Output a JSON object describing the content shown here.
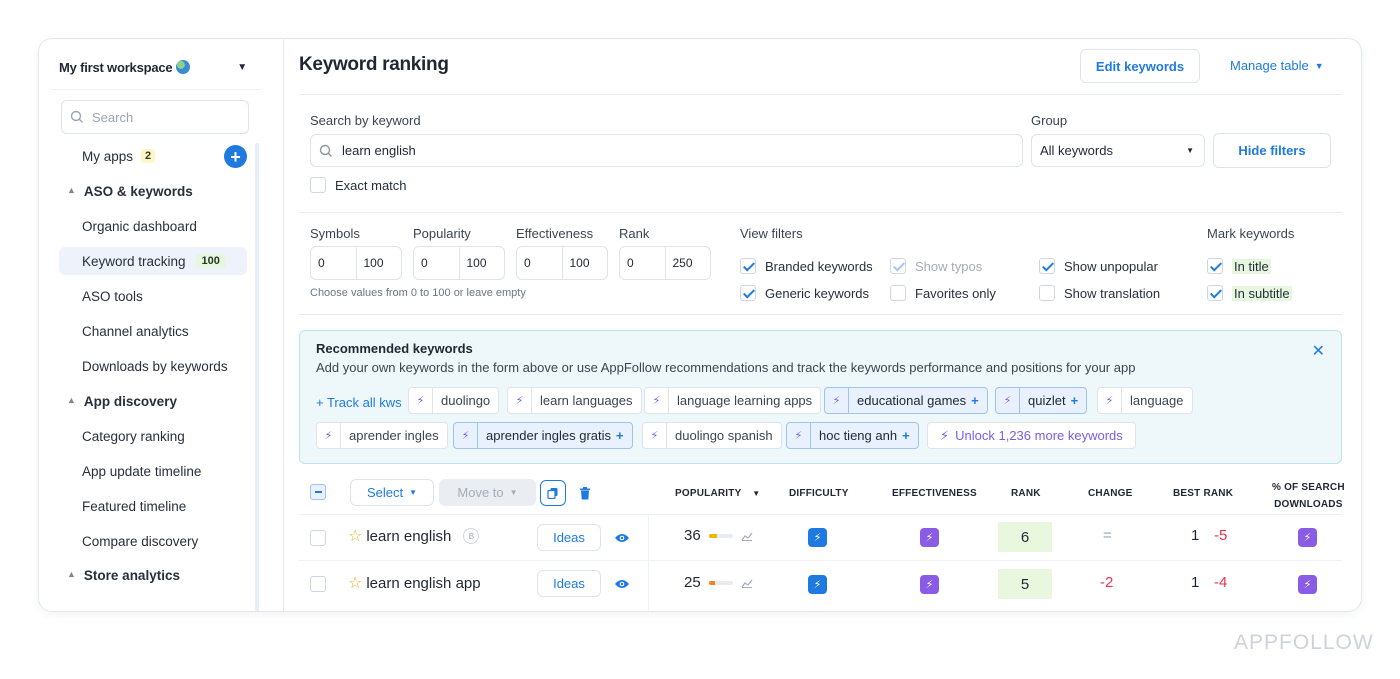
{
  "sidebar": {
    "workspace": "My first workspace",
    "search_placeholder": "Search",
    "my_apps_label": "My apps",
    "my_apps_count": "2",
    "items": [
      {
        "label": "ASO & keywords",
        "type": "section"
      },
      {
        "label": "Organic dashboard"
      },
      {
        "label": "Keyword tracking",
        "badge": "100",
        "active": true
      },
      {
        "label": "ASO tools"
      },
      {
        "label": "Channel analytics"
      },
      {
        "label": "Downloads by keywords"
      },
      {
        "label": "App discovery",
        "type": "section"
      },
      {
        "label": "Category ranking"
      },
      {
        "label": "App update timeline"
      },
      {
        "label": "Featured timeline"
      },
      {
        "label": "Compare discovery"
      },
      {
        "label": "Store analytics",
        "type": "section"
      }
    ]
  },
  "header": {
    "title": "Keyword ranking",
    "edit_keywords": "Edit keywords",
    "manage_table": "Manage table"
  },
  "filters": {
    "search_label": "Search by keyword",
    "search_value": "learn english",
    "exact_match": "Exact match",
    "group_label": "Group",
    "group_value": "All keywords",
    "hide_filters": "Hide filters",
    "ranges": [
      {
        "label": "Symbols",
        "min": "0",
        "max": "100"
      },
      {
        "label": "Popularity",
        "min": "0",
        "max": "100"
      },
      {
        "label": "Effectiveness",
        "min": "0",
        "max": "100"
      },
      {
        "label": "Rank",
        "min": "0",
        "max": "250"
      }
    ],
    "range_hint": "Choose values from 0 to 100 or leave empty",
    "view_filters_label": "View filters",
    "view_filters": [
      {
        "label": "Branded keywords",
        "checked": true
      },
      {
        "label": "Show typos",
        "checked": true,
        "disabled": true
      },
      {
        "label": "Show unpopular",
        "checked": true
      },
      {
        "label": "Generic keywords",
        "checked": true
      },
      {
        "label": "Favorites only",
        "checked": false
      },
      {
        "label": "Show translation",
        "checked": false
      }
    ],
    "mark_keywords_label": "Mark keywords",
    "mark_keywords": [
      {
        "label": "In title",
        "checked": true
      },
      {
        "label": "In subtitle",
        "checked": true
      }
    ]
  },
  "recommended": {
    "title": "Recommended keywords",
    "description": "Add your own keywords in the form above or use AppFollow recommendations and track the keywords performance and positions for your app",
    "track_all": "+ Track all kws",
    "chips_row1": [
      {
        "label": "duolingo",
        "selected": false
      },
      {
        "label": "learn languages",
        "selected": false
      },
      {
        "label": "language learning apps",
        "selected": false
      },
      {
        "label": "educational games",
        "selected": true
      },
      {
        "label": "quizlet",
        "selected": true
      },
      {
        "label": "language",
        "selected": false
      }
    ],
    "chips_row2": [
      {
        "label": "aprender ingles",
        "selected": false
      },
      {
        "label": "aprender ingles gratis",
        "selected": true
      },
      {
        "label": "duolingo spanish",
        "selected": false
      },
      {
        "label": "hoc tieng anh",
        "selected": true
      }
    ],
    "unlock": "Unlock 1,236 more keywords"
  },
  "table": {
    "select_label": "Select",
    "move_to_label": "Move to",
    "columns": {
      "popularity": "POPULARITY",
      "difficulty": "DIFFICULTY",
      "effectiveness": "EFFECTIVENESS",
      "rank": "RANK",
      "change": "CHANGE",
      "best_rank": "BEST RANK",
      "search_downloads_1": "% OF SEARCH",
      "search_downloads_2": "DOWNLOADS"
    },
    "ideas_label": "Ideas",
    "rows": [
      {
        "keyword": "learn english",
        "brand_badge": "B",
        "popularity": "36",
        "popularity_level": 0.36,
        "popularity_color": "#f5b400",
        "rank": "6",
        "change": "=",
        "best_rank": "1",
        "best_rank_delta": "-5"
      },
      {
        "keyword": "learn english app",
        "popularity": "25",
        "popularity_level": 0.25,
        "popularity_color": "#f5821f",
        "rank": "5",
        "change": "-2",
        "best_rank": "1",
        "best_rank_delta": "-4"
      }
    ]
  },
  "brand": "APPFOLLOW",
  "colors": {
    "accent": "#1f7ae0",
    "purple": "#8a5ce6",
    "negative": "#e5354d",
    "rank_bg": "#eaf7df"
  }
}
